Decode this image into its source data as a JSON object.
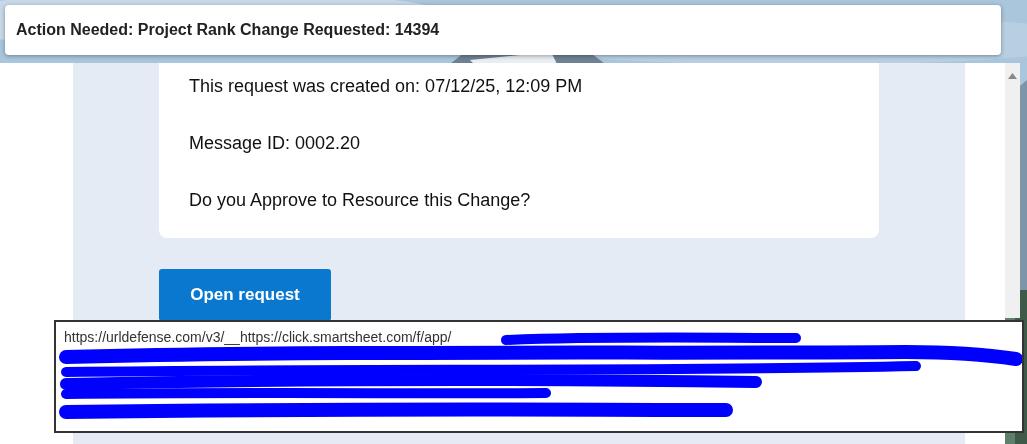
{
  "notification": {
    "title": "Action Needed: Project Rank Change Requested: 14394"
  },
  "message": {
    "lines": [
      "This request was created on: 07/12/25, 12:09 PM",
      "Message ID: 0002.20",
      "Do you Approve to Resource this Change?"
    ]
  },
  "action_button": {
    "label": "Open request"
  },
  "link_tooltip": {
    "url": "https://urldefense.com/v3/__https://click.smartsheet.com/f/app/"
  }
}
